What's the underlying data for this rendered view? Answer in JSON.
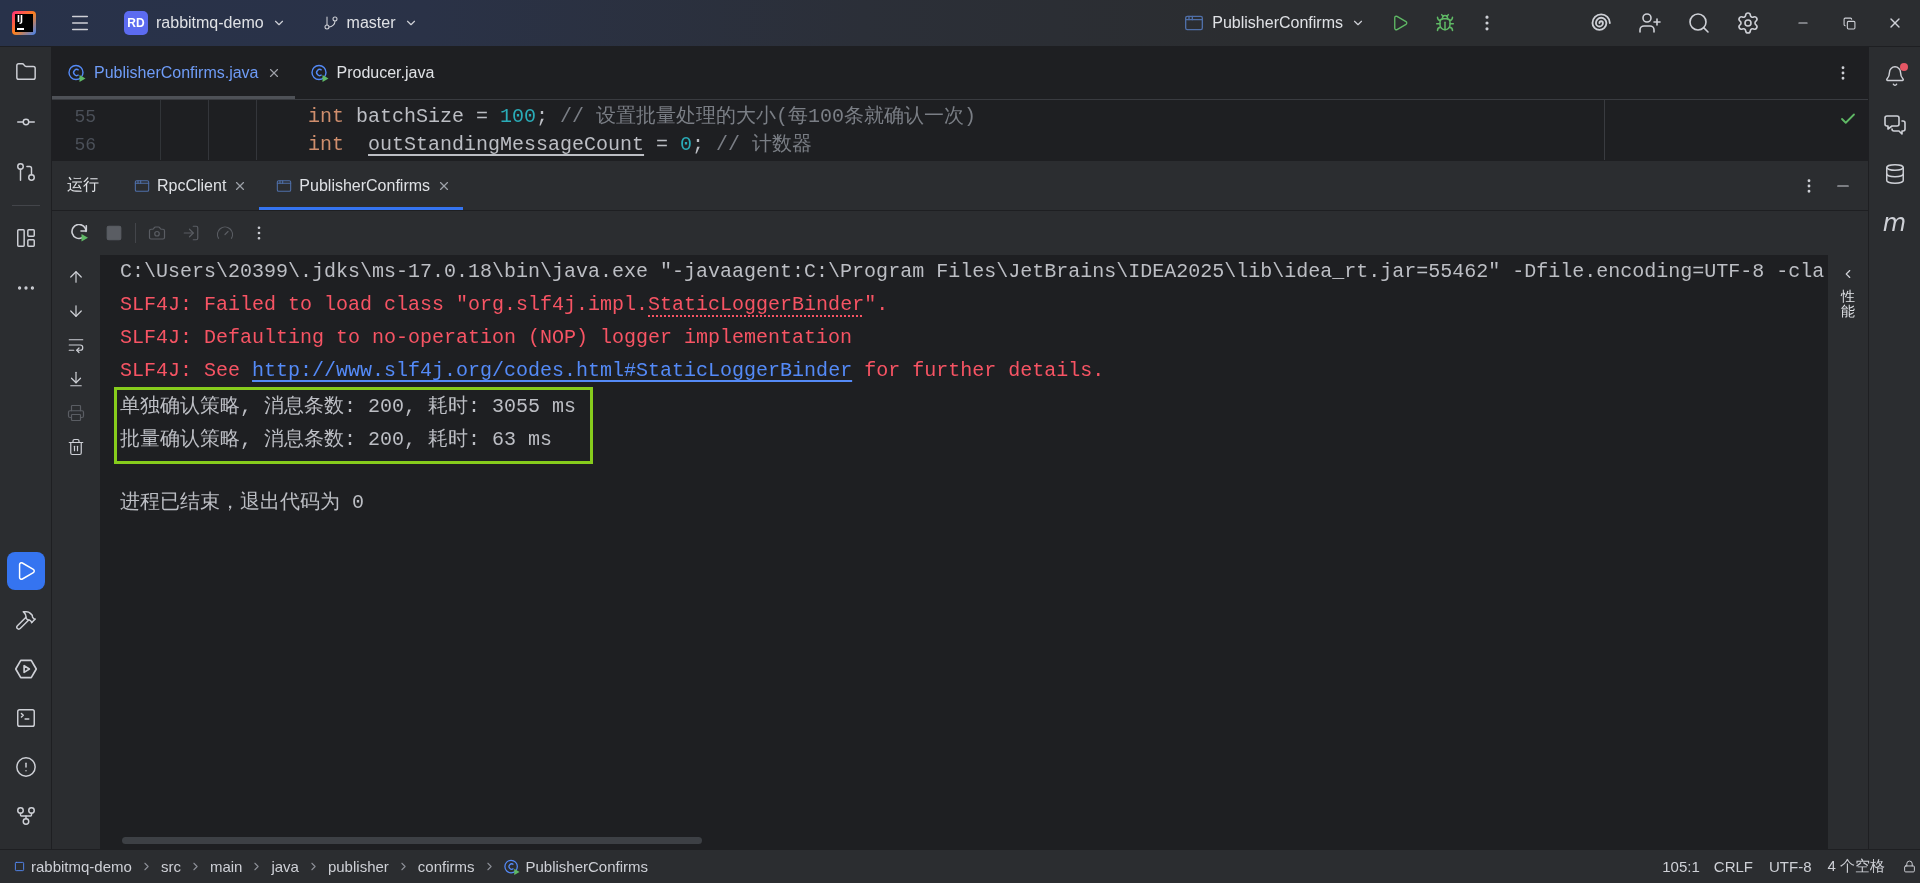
{
  "title_bar": {
    "logo_text": "IJ",
    "project_badge": "RD",
    "project": "rabbitmq-demo",
    "branch": "master",
    "run_configuration": "PublisherConfirms"
  },
  "left_toolbar": {
    "top": [
      [
        {
          "kind": "project",
          "selected": false
        },
        {
          "kind": "commit",
          "selected": false
        },
        {
          "kind": "pull_requests",
          "selected": false
        }
      ],
      [
        {
          "kind": "structure",
          "selected": false
        },
        {
          "kind": "more",
          "selected": false
        }
      ]
    ],
    "bottom": [
      {
        "kind": "run",
        "selected": true
      },
      {
        "kind": "build",
        "selected": false
      },
      {
        "kind": "services",
        "selected": false
      },
      {
        "kind": "terminal",
        "selected": false
      },
      {
        "kind": "problems",
        "selected": false
      },
      {
        "kind": "git",
        "selected": false
      }
    ]
  },
  "editor_tabs": [
    {
      "label": "PublisherConfirms.java",
      "selected": true,
      "modified": true
    },
    {
      "label": "Producer.java",
      "selected": false,
      "modified": false
    }
  ],
  "editor": {
    "inspection_passed": true,
    "lines": [
      {
        "number": "55",
        "tokens": [
          {
            "kind": "keyword",
            "text": "int"
          },
          {
            "kind": "plain",
            "text": " batchSize = "
          },
          {
            "kind": "number",
            "text": "100"
          },
          {
            "kind": "plain",
            "text": "; "
          },
          {
            "kind": "comment",
            "text": "// 设置批量处理的大小(每100条就确认一次)"
          }
        ]
      },
      {
        "number": "56",
        "tokens": [
          {
            "kind": "keyword",
            "text": "int  "
          },
          {
            "kind": "reassigned",
            "text": "outStandingMessageCount"
          },
          {
            "kind": "plain",
            "text": " = "
          },
          {
            "kind": "number",
            "text": "0"
          },
          {
            "kind": "plain",
            "text": "; "
          },
          {
            "kind": "comment",
            "text": "// 计数器"
          }
        ]
      }
    ]
  },
  "run_window": {
    "title": "运行",
    "tabs": [
      {
        "label": "RpcClient",
        "selected": false
      },
      {
        "label": "PublisherConfirms",
        "selected": true
      }
    ],
    "toolbar": [
      [
        {
          "kind": "rerun",
          "disabled": false
        },
        {
          "kind": "stop",
          "disabled": true
        }
      ],
      [
        {
          "kind": "screenshot",
          "disabled": true
        },
        {
          "kind": "attach",
          "disabled": true
        },
        {
          "kind": "profiler",
          "disabled": true
        },
        {
          "kind": "more",
          "disabled": false
        }
      ]
    ],
    "gutter": [
      {
        "kind": "up",
        "disabled": false
      },
      {
        "kind": "down",
        "disabled": false
      },
      {
        "kind": "soft_wrap",
        "disabled": false
      },
      {
        "kind": "scroll_to_end",
        "disabled": false
      },
      {
        "kind": "print",
        "disabled": true
      },
      {
        "kind": "clear",
        "disabled": false
      }
    ],
    "console": [
      {
        "kind": "command",
        "boxed": false,
        "segments": [
          {
            "kind": "text",
            "text": "C:\\Users\\20399\\.jdks\\ms-17.0.18\\bin\\java.exe \"-javaagent:C:\\Program Files\\JetBrains\\IDEA2025\\lib\\idea_rt.jar=55462\" -Dfile.encoding=UTF-8 -cla"
          }
        ]
      },
      {
        "kind": "stderr",
        "boxed": false,
        "segments": [
          {
            "kind": "text",
            "text": "SLF4J: Failed to load class \"org.slf4j.impl."
          },
          {
            "kind": "dotted",
            "text": "StaticLoggerBinder"
          },
          {
            "kind": "text",
            "text": "\"."
          }
        ]
      },
      {
        "kind": "stderr",
        "boxed": false,
        "segments": [
          {
            "kind": "text",
            "text": "SLF4J: Defaulting to no-operation (NOP) logger implementation"
          }
        ]
      },
      {
        "kind": "stderr",
        "boxed": false,
        "segments": [
          {
            "kind": "text",
            "text": "SLF4J: See "
          },
          {
            "kind": "link",
            "text": "http://www.slf4j.org/codes.html#StaticLoggerBinder"
          },
          {
            "kind": "text",
            "text": " for further details."
          }
        ]
      },
      {
        "kind": "stdout",
        "boxed": true,
        "segments": [
          {
            "kind": "text",
            "text": "单独确认策略, 消息条数: 200, 耗时: 3055 ms"
          }
        ]
      },
      {
        "kind": "stdout",
        "boxed": true,
        "segments": [
          {
            "kind": "text",
            "text": "批量确认策略, 消息条数: 200, 耗时: 63 ms"
          }
        ]
      },
      {
        "kind": "exit",
        "boxed": false,
        "segments": [
          {
            "kind": "text",
            "text": "进程已结束，退出代码为 0"
          }
        ]
      }
    ],
    "side_panel_label": "性能"
  },
  "right_toolbar": [
    {
      "kind": "notifications",
      "unread": true
    },
    {
      "kind": "ai_chat"
    },
    {
      "kind": "database"
    },
    {
      "kind": "maven",
      "glyph": "m"
    }
  ],
  "status_bar": {
    "breadcrumbs": [
      {
        "kind": "module",
        "label": "rabbitmq-demo"
      },
      {
        "kind": "folder",
        "label": "src"
      },
      {
        "kind": "folder",
        "label": "main"
      },
      {
        "kind": "folder",
        "label": "java"
      },
      {
        "kind": "folder",
        "label": "publisher"
      },
      {
        "kind": "folder",
        "label": "confirms"
      },
      {
        "kind": "class",
        "label": "PublisherConfirms"
      }
    ],
    "position": "105:1",
    "line_separator": "CRLF",
    "encoding": "UTF-8",
    "indent": "4 个空格"
  }
}
